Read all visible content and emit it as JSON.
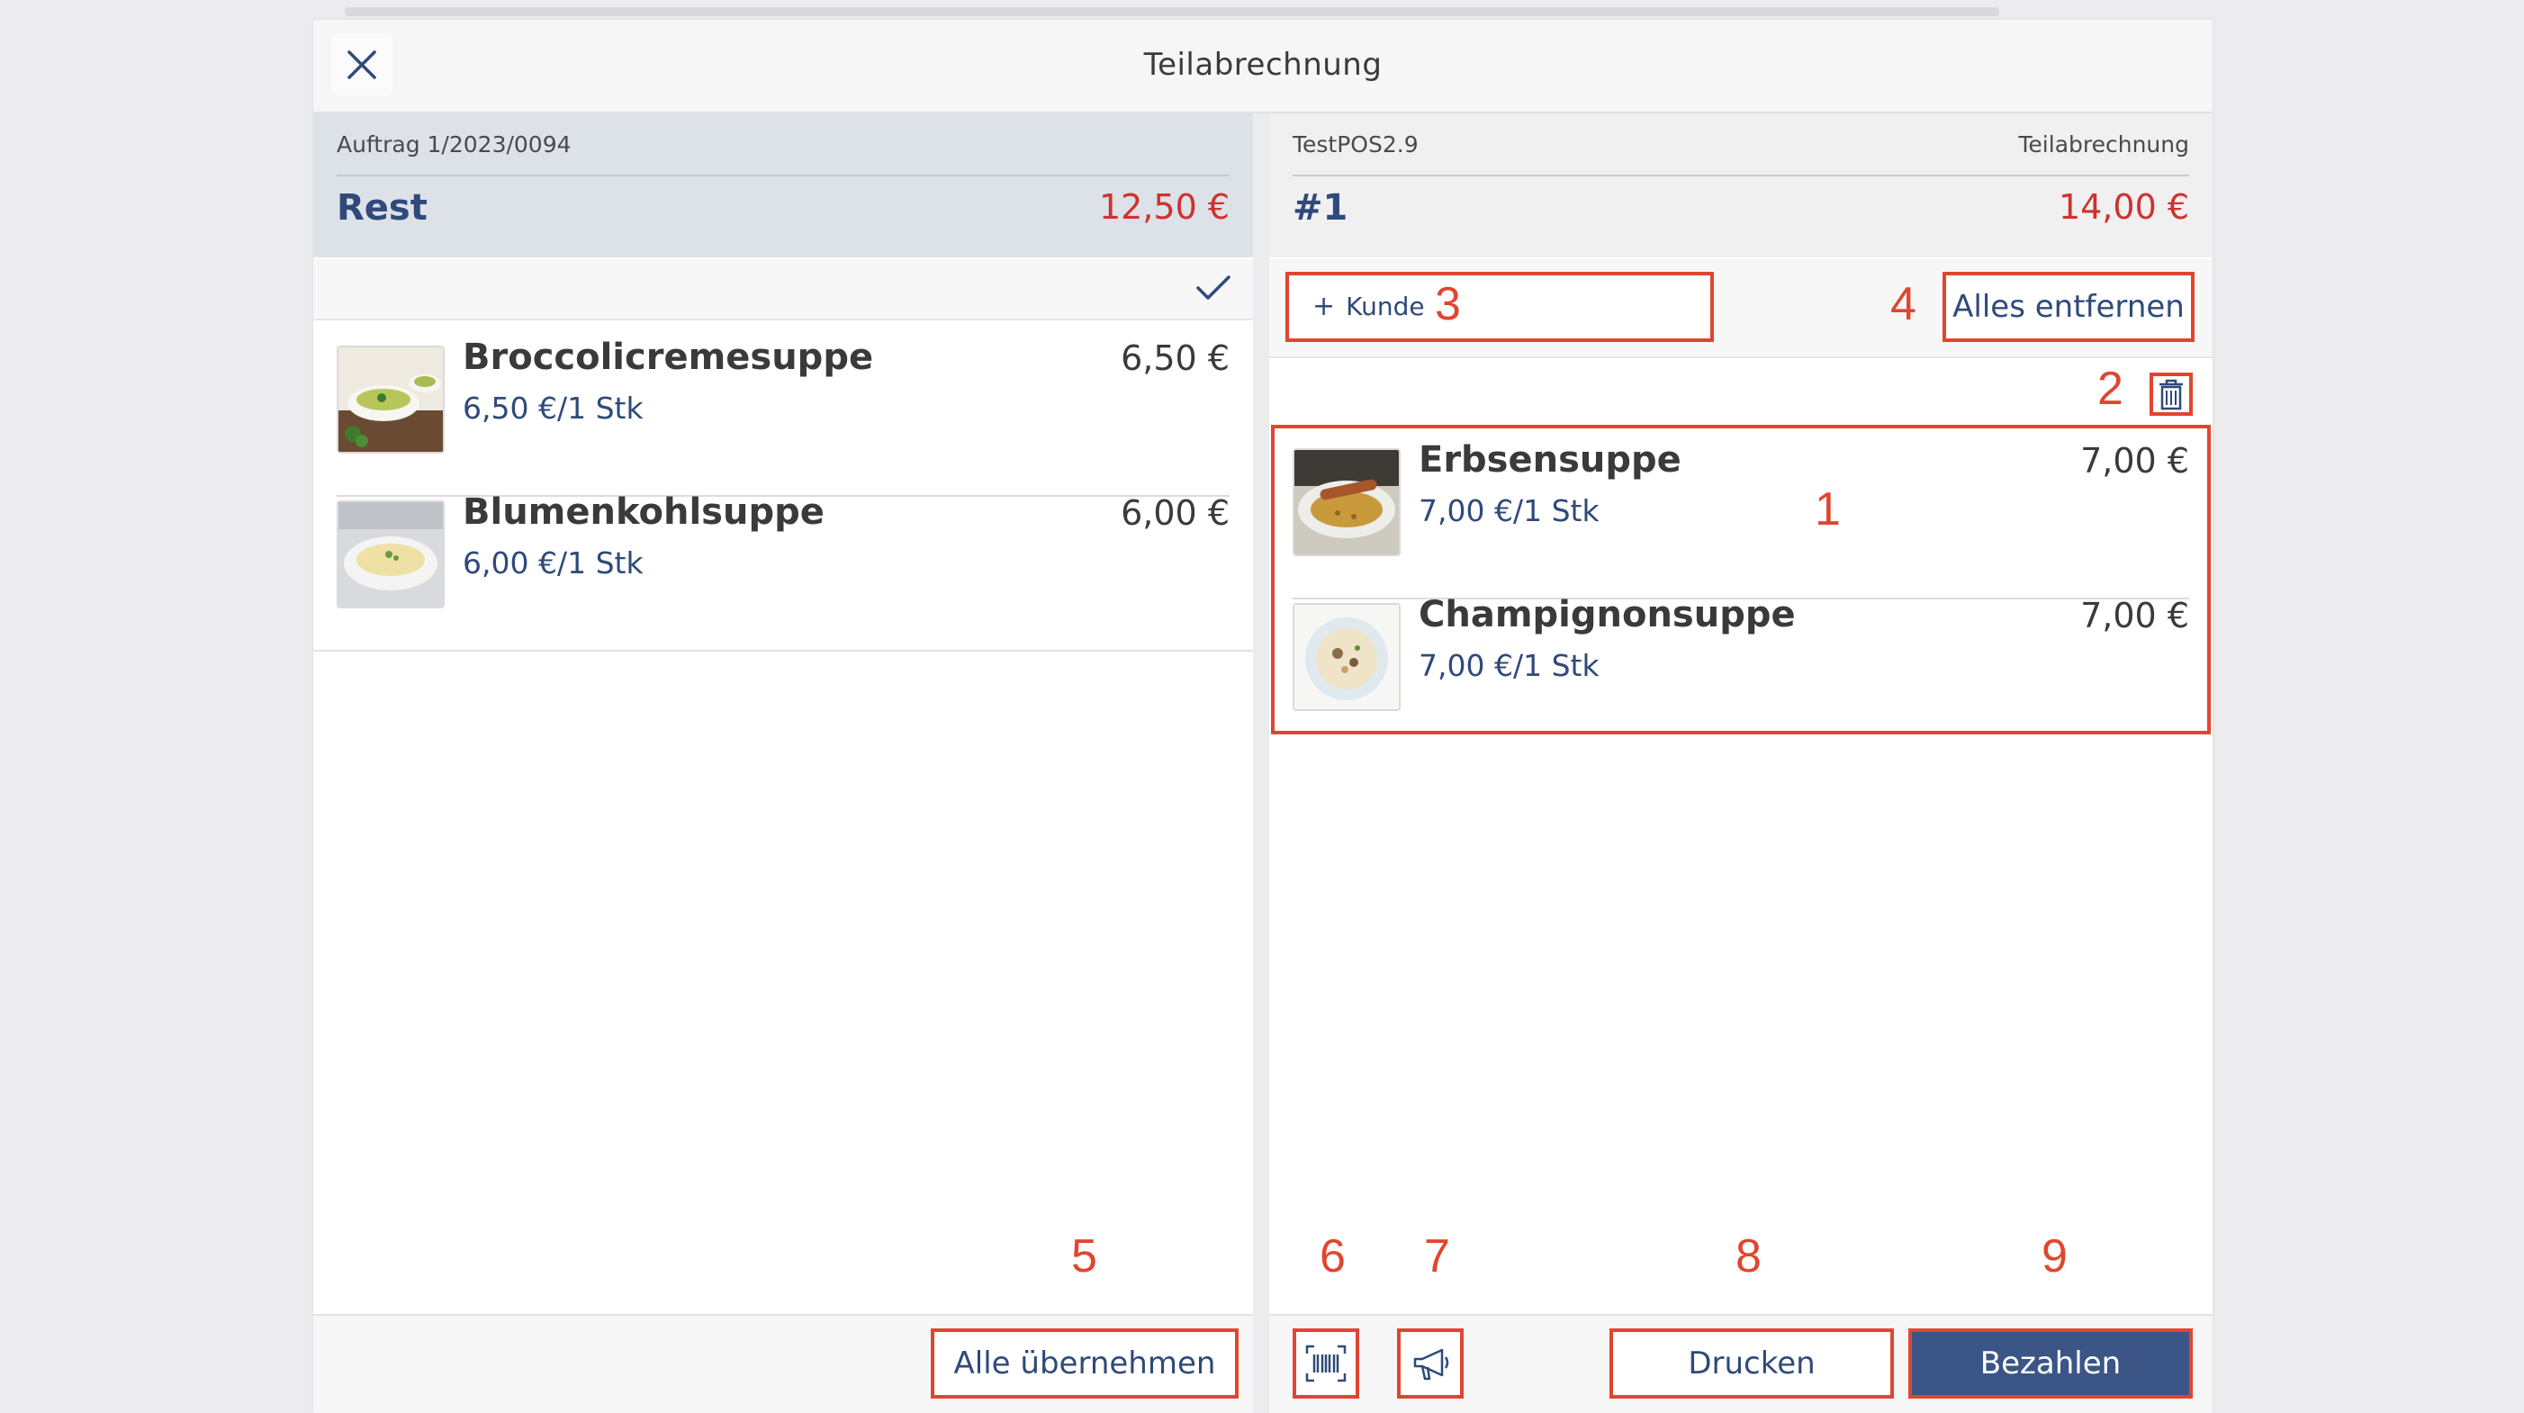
{
  "header": {
    "title": "Teilabrechnung"
  },
  "left": {
    "order_label": "Auftrag 1/2023/0094",
    "rest_label": "Rest",
    "rest_amount": "12,50 €",
    "items": [
      {
        "name": "Broccolicremesuppe",
        "unit": "6,50 €/1 Stk",
        "price": "6,50 €"
      },
      {
        "name": "Blumenkohlsuppe",
        "unit": "6,00 €/1 Stk",
        "price": "6,00 €"
      }
    ],
    "take_all_label": "Alle übernehmen"
  },
  "right": {
    "pos_label": "TestPOS2.9",
    "mode_label": "Teilabrechnung",
    "bill_number": "#1",
    "bill_amount": "14,00 €",
    "customer_label": "Kunde",
    "remove_all_label": "Alles entfernen",
    "items": [
      {
        "name": "Erbsensuppe",
        "unit": "7,00 €/1 Stk",
        "price": "7,00 €"
      },
      {
        "name": "Champignonsuppe",
        "unit": "7,00 €/1 Stk",
        "price": "7,00 €"
      }
    ],
    "print_label": "Drucken",
    "pay_label": "Bezahlen"
  },
  "annotations": {
    "n1": "1",
    "n2": "2",
    "n3": "3",
    "n4": "4",
    "n5": "5",
    "n6": "6",
    "n7": "7",
    "n8": "8",
    "n9": "9"
  },
  "colors": {
    "accent": "#2f4a7a",
    "amount": "#d0312d",
    "annotation": "#e0462f",
    "primary_button": "#3b5586"
  },
  "icons": [
    "close-icon",
    "check-icon",
    "plus-icon",
    "trash-icon",
    "barcode-icon",
    "megaphone-icon"
  ]
}
